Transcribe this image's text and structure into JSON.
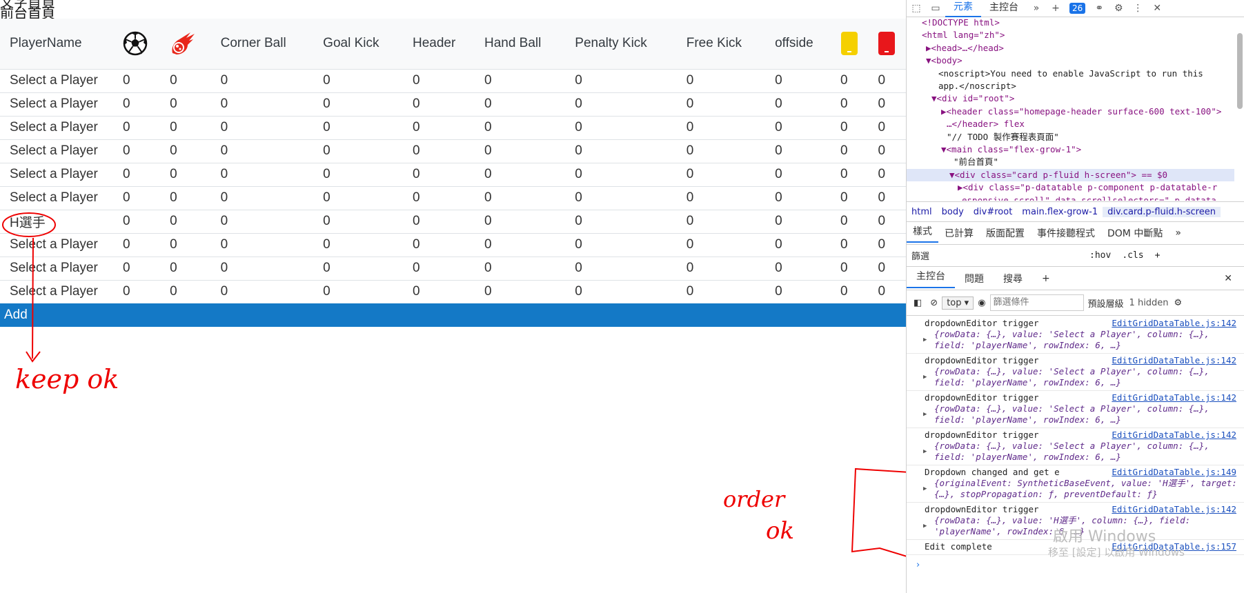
{
  "page": {
    "cut_title": "文字首頁",
    "title": "前台首頁"
  },
  "table": {
    "headers": [
      "PlayerName",
      "",
      "",
      "Corner Ball",
      "Goal Kick",
      "Header",
      "Hand Ball",
      "Penalty Kick",
      "Free Kick",
      "offside",
      "",
      ""
    ],
    "header_icons": [
      "soccer-ball-icon",
      "fire-ball-icon",
      "yellow-card-icon",
      "red-card-icon"
    ],
    "rows": [
      [
        "Select a Player",
        "0",
        "0",
        "0",
        "0",
        "0",
        "0",
        "0",
        "0",
        "0",
        "0",
        "0"
      ],
      [
        "Select a Player",
        "0",
        "0",
        "0",
        "0",
        "0",
        "0",
        "0",
        "0",
        "0",
        "0",
        "0"
      ],
      [
        "Select a Player",
        "0",
        "0",
        "0",
        "0",
        "0",
        "0",
        "0",
        "0",
        "0",
        "0",
        "0"
      ],
      [
        "Select a Player",
        "0",
        "0",
        "0",
        "0",
        "0",
        "0",
        "0",
        "0",
        "0",
        "0",
        "0"
      ],
      [
        "Select a Player",
        "0",
        "0",
        "0",
        "0",
        "0",
        "0",
        "0",
        "0",
        "0",
        "0",
        "0"
      ],
      [
        "Select a Player",
        "0",
        "0",
        "0",
        "0",
        "0",
        "0",
        "0",
        "0",
        "0",
        "0",
        "0"
      ],
      [
        "H選手",
        "0",
        "0",
        "0",
        "0",
        "0",
        "0",
        "0",
        "0",
        "0",
        "0",
        "0"
      ],
      [
        "Select a Player",
        "0",
        "0",
        "0",
        "0",
        "0",
        "0",
        "0",
        "0",
        "0",
        "0",
        "0"
      ],
      [
        "Select a Player",
        "0",
        "0",
        "0",
        "0",
        "0",
        "0",
        "0",
        "0",
        "0",
        "0",
        "0"
      ],
      [
        "Select a Player",
        "0",
        "0",
        "0",
        "0",
        "0",
        "0",
        "0",
        "0",
        "0",
        "0",
        "0"
      ]
    ],
    "add_label": "Add"
  },
  "annotations": {
    "keep": "keep ok",
    "order": "order",
    "order_ok": "ok"
  },
  "colors": {
    "accent": "#1479c6",
    "annotation": "#e00000",
    "yellow_card": "#f5d000",
    "red_card": "#e8171b"
  },
  "devtools": {
    "tabs": [
      "元素",
      "主控台"
    ],
    "issues_count": "26",
    "dom_lines": [
      {
        "t": "<!DOCTYPE html>"
      },
      {
        "t": "<html lang=\"zh\">"
      },
      {
        "t": "▶<head>…</head>"
      },
      {
        "t": "▼<body>"
      },
      {
        "t": "<noscript>You need to enable JavaScript to run this"
      },
      {
        "t": "app.</noscript>"
      },
      {
        "t": "▼<div id=\"root\">"
      },
      {
        "t": "▶<header class=\"homepage-header surface-600 text-100\">"
      },
      {
        "t": "…</header> flex"
      },
      {
        "t": "\"// TODO 製作賽程表頁面\""
      },
      {
        "t": "▼<main class=\"flex-grow-1\">"
      },
      {
        "t": "\"前台首頁\""
      },
      {
        "t": "▼<div class=\"card p-fluid h-screen\"> == $0"
      },
      {
        "t": "▶<div class=\"p-datatable p-component p-datatable-r"
      },
      {
        "t": "esponsive-scroll\" data-scrollselectors=\".p-datata"
      }
    ],
    "breadcrumbs": [
      "html",
      "body",
      "div#root",
      "main.flex-grow-1",
      "div.card.p-fluid.h-screen"
    ],
    "styles_tabs": [
      "樣式",
      "已計算",
      "版面配置",
      "事件接聽程式",
      "DOM 中斷點"
    ],
    "filter_label": "篩選",
    "filter_buttons": [
      ":hov",
      ".cls"
    ],
    "drawer_tabs": [
      "主控台",
      "問題",
      "搜尋"
    ],
    "console_context": "top",
    "console_filter_placeholder": "篩選條件",
    "console_levels": "預設層級",
    "console_hidden": "1 hidden",
    "log": [
      {
        "msg": "dropdownEditor trigger",
        "src": "EditGridDataTable.js:142",
        "obj": "{rowData: {…}, value: 'Select a Player', column: {…}, field: 'playerName', rowIndex: 6, …}"
      },
      {
        "msg": "dropdownEditor trigger",
        "src": "EditGridDataTable.js:142",
        "obj": "{rowData: {…}, value: 'Select a Player', column: {…}, field: 'playerName', rowIndex: 6, …}"
      },
      {
        "msg": "dropdownEditor trigger",
        "src": "EditGridDataTable.js:142",
        "obj": "{rowData: {…}, value: 'Select a Player', column: {…}, field: 'playerName', rowIndex: 6, …}"
      },
      {
        "msg": "dropdownEditor trigger",
        "src": "EditGridDataTable.js:142",
        "obj": "{rowData: {…}, value: 'Select a Player', column: {…}, field: 'playerName', rowIndex: 6, …}"
      },
      {
        "msg": "Dropdown changed and get e",
        "src": "EditGridDataTable.js:149",
        "obj": "{originalEvent: SyntheticBaseEvent, value: 'H選手', target: {…}, stopPropagation: ƒ, preventDefault: ƒ}"
      },
      {
        "msg": "dropdownEditor trigger",
        "src": "EditGridDataTable.js:142",
        "obj": "{rowData: {…}, value: 'H選手', column: {…}, field: 'playerName', rowIndex: 6, …}"
      },
      {
        "msg": "Edit complete",
        "src": "EditGridDataTable.js:157",
        "obj": ""
      }
    ],
    "watermark_line1": "啟用 Windows",
    "watermark_line2": "移至 [設定] 以啟用 Windows"
  }
}
